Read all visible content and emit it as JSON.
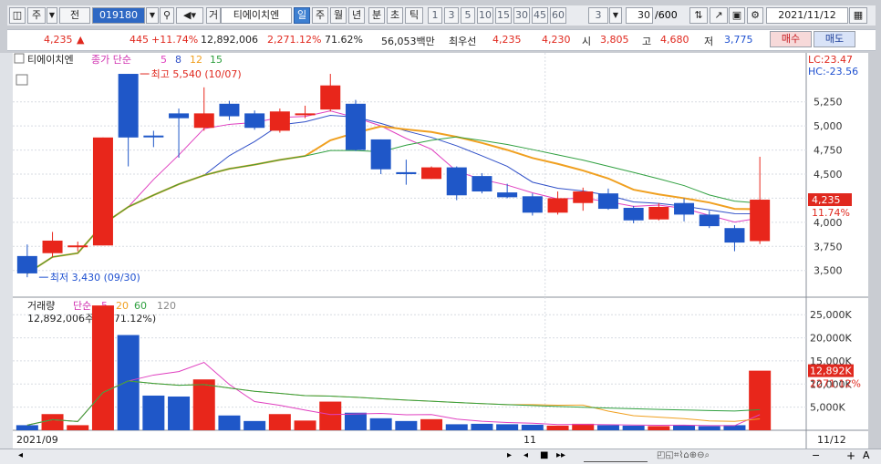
{
  "toolbar": {
    "items": [
      "주",
      "전",
      "019180",
      "거",
      "티에이치엔",
      "일",
      "주",
      "월",
      "년",
      "분",
      "초",
      "틱",
      "1",
      "3",
      "5",
      "10",
      "15",
      "30",
      "45",
      "60",
      "3",
      "30",
      "/600",
      "2021/11/12"
    ]
  },
  "info": {
    "price": "4,235",
    "change": "445",
    "change_pct": "+11.74%",
    "volume": "12,892,006",
    "vol_ratio": "2,271.12%",
    "pct2": "71.62%",
    "amount": "56,053백만",
    "best_label": "최우선",
    "ask": "4,235",
    "bid": "4,230",
    "open_label": "시",
    "open": "3,805",
    "high_label": "고",
    "high": "4,680",
    "low_label": "저",
    "low": "3,775",
    "buy_btn": "매수",
    "sell_btn": "매도"
  },
  "price_panel": {
    "name": "티에이치엔",
    "ma_label": "종가 단순",
    "ma_periods": [
      "5",
      "8",
      "12",
      "15"
    ],
    "max_label": "최고 5,540 (10/07)",
    "min_label": "최저 3,430 (09/30)",
    "lc": "LC:23.47",
    "hc": "HC:-23.56",
    "current_price_tag": "4,235",
    "current_pct_tag": "11.74%",
    "yticks": [
      "5,250",
      "5,000",
      "4,750",
      "4,500",
      "4,250",
      "4,000",
      "3,750",
      "3,500"
    ]
  },
  "volume_panel": {
    "title": "거래량",
    "ma_label": "단순",
    "ma_periods": [
      "5",
      "20",
      "60",
      "120"
    ],
    "current_label": "12,892,006주(2,271.12%)",
    "yticks": [
      "25,000K",
      "20,000K",
      "15,000K",
      "10,000K",
      "5,000K"
    ],
    "current_tag": "12,892K",
    "current_pct_tag": "2271.12%"
  },
  "xaxis": {
    "left_label": "2021/09",
    "mid_label": "11",
    "right_label": "11/12"
  },
  "colors": {
    "up": "#e8261b",
    "down": "#1f57c8",
    "ma5": "#e040c0",
    "ma8": "#3050c8",
    "ma12": "#f0a020",
    "ma15": "#30a040"
  },
  "chart_data": {
    "type": "candlestick",
    "candles": [
      {
        "o": 3650,
        "h": 3770,
        "l": 3430,
        "c": 3470
      },
      {
        "o": 3680,
        "h": 3900,
        "l": 3640,
        "c": 3810
      },
      {
        "o": 3750,
        "h": 3800,
        "l": 3700,
        "c": 3760
      },
      {
        "o": 3760,
        "h": 4880,
        "l": 3760,
        "c": 4880
      },
      {
        "o": 5540,
        "h": 5540,
        "l": 4580,
        "c": 4880
      },
      {
        "o": 4900,
        "h": 4950,
        "l": 4780,
        "c": 4890
      },
      {
        "o": 5130,
        "h": 5180,
        "l": 4670,
        "c": 5080
      },
      {
        "o": 4980,
        "h": 5400,
        "l": 4950,
        "c": 5130
      },
      {
        "o": 5230,
        "h": 5260,
        "l": 5060,
        "c": 5100
      },
      {
        "o": 5130,
        "h": 5160,
        "l": 4960,
        "c": 4980
      },
      {
        "o": 4950,
        "h": 5180,
        "l": 4930,
        "c": 5150
      },
      {
        "o": 5120,
        "h": 5210,
        "l": 5080,
        "c": 5130
      },
      {
        "o": 5170,
        "h": 5540,
        "l": 5150,
        "c": 5420
      },
      {
        "o": 5230,
        "h": 5270,
        "l": 4740,
        "c": 4750
      },
      {
        "o": 4860,
        "h": 4860,
        "l": 4500,
        "c": 4550
      },
      {
        "o": 4520,
        "h": 4650,
        "l": 4390,
        "c": 4500
      },
      {
        "o": 4450,
        "h": 4580,
        "l": 4450,
        "c": 4570
      },
      {
        "o": 4570,
        "h": 4580,
        "l": 4230,
        "c": 4280
      },
      {
        "o": 4480,
        "h": 4510,
        "l": 4300,
        "c": 4320
      },
      {
        "o": 4310,
        "h": 4400,
        "l": 4250,
        "c": 4260
      },
      {
        "o": 4270,
        "h": 4300,
        "l": 4070,
        "c": 4100
      },
      {
        "o": 4100,
        "h": 4320,
        "l": 4080,
        "c": 4250
      },
      {
        "o": 4200,
        "h": 4360,
        "l": 4120,
        "c": 4320
      },
      {
        "o": 4300,
        "h": 4350,
        "l": 4130,
        "c": 4140
      },
      {
        "o": 4150,
        "h": 4170,
        "l": 3990,
        "c": 4020
      },
      {
        "o": 4030,
        "h": 4200,
        "l": 4020,
        "c": 4160
      },
      {
        "o": 4200,
        "h": 4250,
        "l": 4010,
        "c": 4080
      },
      {
        "o": 4080,
        "h": 4120,
        "l": 3940,
        "c": 3960
      },
      {
        "o": 3940,
        "h": 3970,
        "l": 3700,
        "c": 3790
      },
      {
        "o": 3805,
        "h": 4680,
        "l": 3775,
        "c": 4235
      }
    ],
    "volume_k": [
      1100,
      3500,
      1100,
      27000,
      20600,
      7500,
      7300,
      11000,
      3200,
      2000,
      3500,
      2100,
      6200,
      3800,
      2600,
      2000,
      2400,
      1300,
      1400,
      1300,
      1200,
      1000,
      1400,
      1100,
      1000,
      900,
      1100,
      900,
      1100,
      12892
    ],
    "ylim_price": [
      3280,
      5720
    ],
    "ylim_volume": [
      0,
      28000
    ]
  }
}
